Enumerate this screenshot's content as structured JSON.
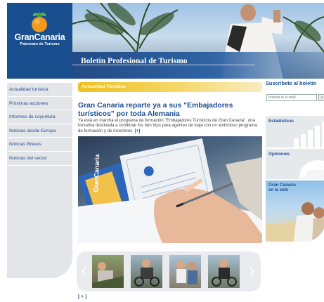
{
  "brand": {
    "name": "GranCanaria",
    "subtitle": "Patronato de Turismo"
  },
  "header": {
    "title": "Boletín Profesional de Turismo"
  },
  "nav": {
    "items": [
      {
        "label": "Actualidad turística"
      },
      {
        "label": "Próximas acciones"
      },
      {
        "label": "Informes de coyuntura"
      },
      {
        "label": "Noticias desde Europa"
      },
      {
        "label": "Noticias Breves"
      },
      {
        "label": "Noticias del sector"
      }
    ]
  },
  "main": {
    "section_label": "Actualidad Turística",
    "headline": "Gran Canaria reparte ya a sus \"Embajadores turísticos\" por toda Alemania",
    "summary": "Ya está en marcha el programa de formación \"Embajadores Turísticos de Gran Canaria\", una iniciativa destinada a combinar los fam trips para agentes de viaje con un ambicioso programa de formación y de incentivos.",
    "more_label": "[+]",
    "bottom_more_label": "[ + ]"
  },
  "sidebar": {
    "subscribe_title": "Suscríbete al boletín",
    "email_placeholder": "Inserta tu e-mail",
    "estadisticas": "Estadísticas",
    "opiniones": "Opiniones",
    "web_title_line1": "Gran Canaria",
    "web_title_line2": "en la web"
  },
  "colors": {
    "brand_blue": "#1a4f8f",
    "link_blue": "#1c4f96",
    "section_yellow": "#f0bf1a",
    "nav_bg": "#e3e5e8"
  },
  "icons": {
    "logo": "orange-fruit-icon",
    "prev": "chevron-left-icon",
    "next": "chevron-right-icon"
  }
}
